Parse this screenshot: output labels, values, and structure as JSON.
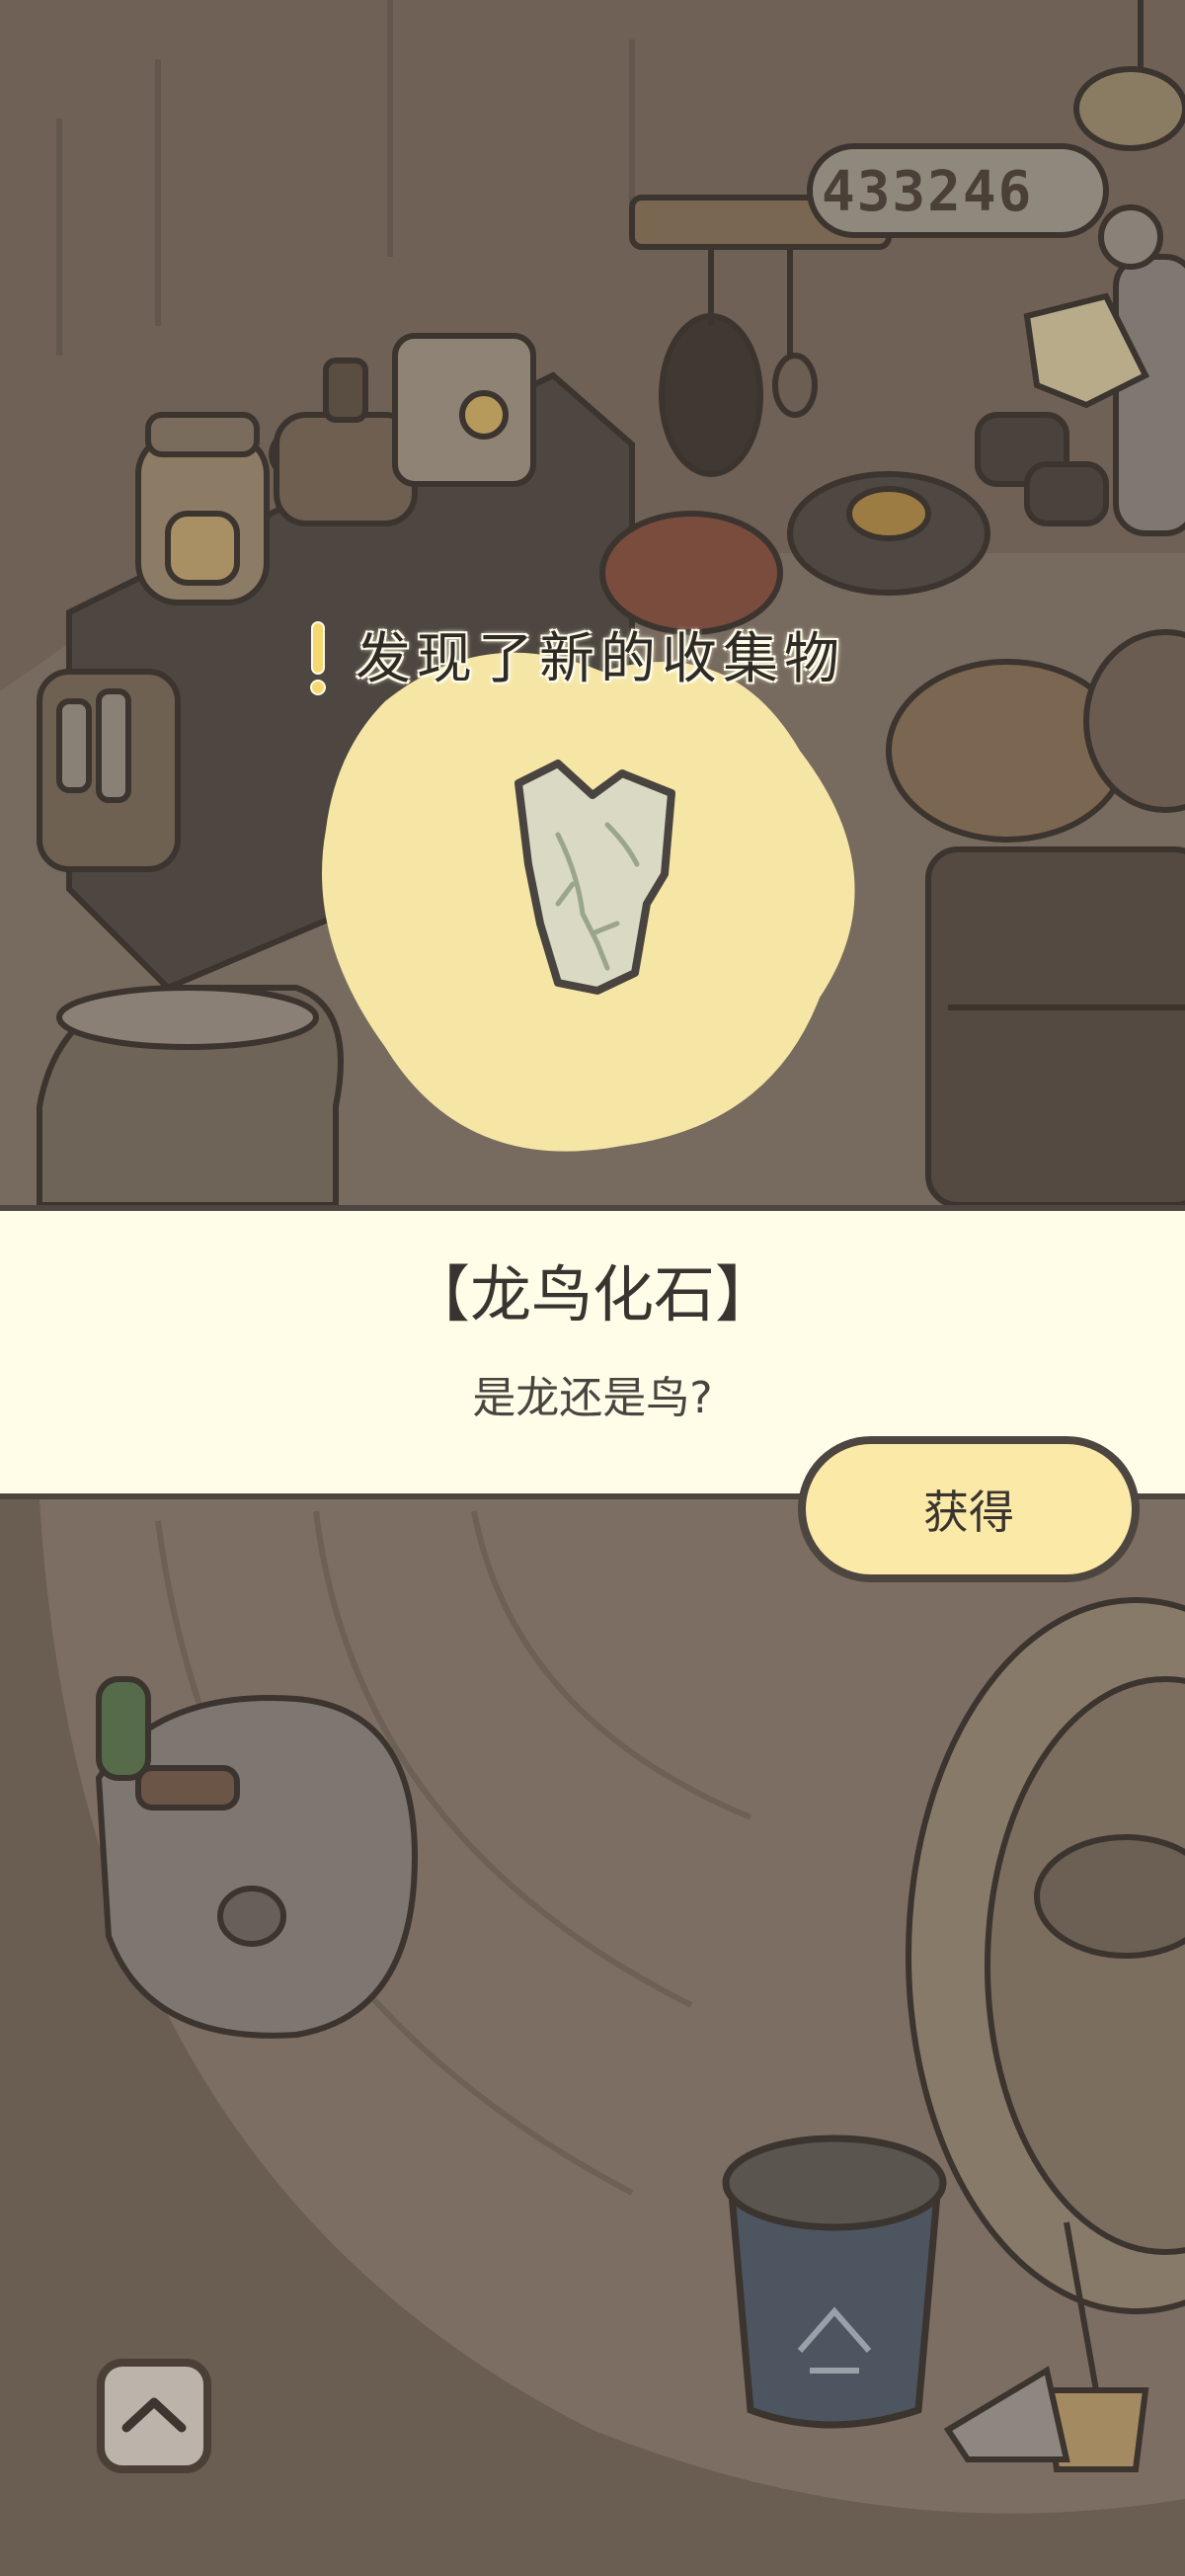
{
  "currency": {
    "clover_count": "433246"
  },
  "discovery": {
    "banner_title": "发现了新的收集物",
    "item_name": "【龙鸟化石】",
    "item_description": "是龙还是鸟?",
    "item_icon": "fossil-icon",
    "get_button_label": "获得"
  },
  "controls": {
    "expand_icon": "chevron-up-icon"
  },
  "colors": {
    "overlay_dim": "#6a5c50",
    "card_bg": "#fffde8",
    "button_bg": "#fbe9a8",
    "glow": "#f5e6a6",
    "outline": "#4d4540"
  }
}
